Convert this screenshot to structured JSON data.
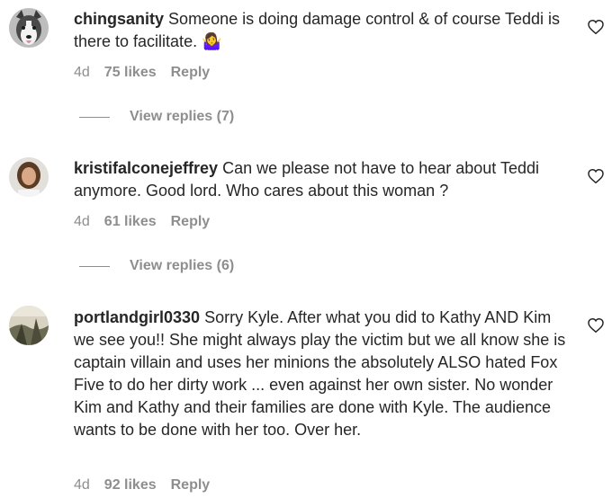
{
  "comments": [
    {
      "username": "chingsanity",
      "text": "Someone is doing damage control & of course Teddi is there to facilitate. 🤷‍♀️",
      "age": "4d",
      "likes": "75 likes",
      "reply_label": "Reply",
      "view_replies": "View replies (7)"
    },
    {
      "username": "kristifalconejeffrey",
      "text": "Can we please not have to hear about Teddi anymore. Good lord. Who cares about this woman ?",
      "age": "4d",
      "likes": "61 likes",
      "reply_label": "Reply",
      "view_replies": "View replies (6)"
    },
    {
      "username": "portlandgirl0330",
      "text": "Sorry Kyle. After what you did to Kathy AND Kim we see you!! She might always play the victim but we all know she is captain villain and uses her minions the absolutely ALSO hated Fox Five to do her dirty work ... even against her own sister. No wonder Kim and Kathy and their families are done with Kyle. The audience wants to be done with her too. Over her.",
      "age": "4d",
      "likes": "92 likes",
      "reply_label": "Reply"
    }
  ],
  "icons": {
    "like": "heart-outline-icon"
  },
  "colors": {
    "text": "#262626",
    "meta": "#8e8e8e"
  }
}
